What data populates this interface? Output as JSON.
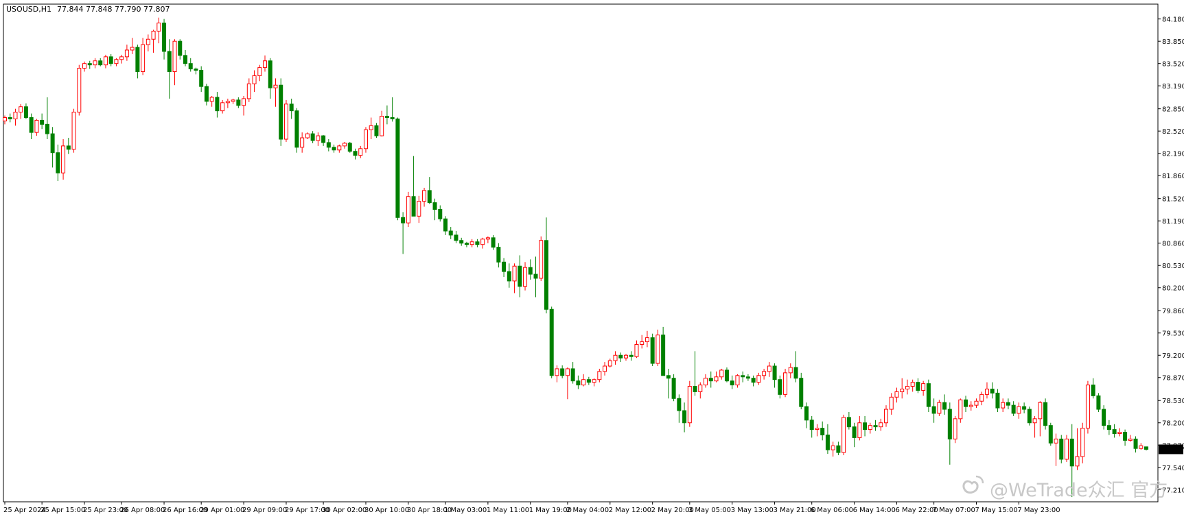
{
  "header": {
    "symbol": "USOUSD,H1",
    "ohlc": "77.844 77.848 77.790 77.807"
  },
  "watermark": {
    "text": "@WeTrade众汇 官方"
  },
  "colors": {
    "bull": "#ff0000",
    "bear": "#008000",
    "frame": "#000000",
    "price_tag_bg": "#000000",
    "price_tag_text": "#ffffff"
  },
  "chart_data": {
    "type": "candlestick",
    "ylim": [
      77.03,
      84.4
    ],
    "current_price": "77.807",
    "y_ticks": [
      "84.180",
      "83.850",
      "83.520",
      "83.190",
      "82.850",
      "82.520",
      "82.190",
      "81.860",
      "81.520",
      "81.190",
      "80.860",
      "80.530",
      "80.200",
      "79.860",
      "79.530",
      "79.200",
      "78.870",
      "78.530",
      "78.200",
      "77.870",
      "77.540",
      "77.210"
    ],
    "x_ticks": [
      {
        "label": "25 Apr 2024",
        "index": 0
      },
      {
        "label": "25 Apr 15:00",
        "index": 7
      },
      {
        "label": "25 Apr 23:00",
        "index": 15
      },
      {
        "label": "26 Apr 08:00",
        "index": 22
      },
      {
        "label": "26 Apr 16:00",
        "index": 30
      },
      {
        "label": "29 Apr 01:00",
        "index": 37
      },
      {
        "label": "29 Apr 09:00",
        "index": 45
      },
      {
        "label": "29 Apr 17:00",
        "index": 53
      },
      {
        "label": "30 Apr 02:00",
        "index": 60
      },
      {
        "label": "30 Apr 10:00",
        "index": 68
      },
      {
        "label": "30 Apr 18:00",
        "index": 76
      },
      {
        "label": "1 May 03:00",
        "index": 83
      },
      {
        "label": "1 May 11:00",
        "index": 91
      },
      {
        "label": "1 May 19:00",
        "index": 99
      },
      {
        "label": "2 May 04:00",
        "index": 106
      },
      {
        "label": "2 May 12:00",
        "index": 114
      },
      {
        "label": "2 May 20:00",
        "index": 122
      },
      {
        "label": "3 May 05:00",
        "index": 129
      },
      {
        "label": "3 May 13:00",
        "index": 137
      },
      {
        "label": "3 May 21:00",
        "index": 145
      },
      {
        "label": "6 May 06:00",
        "index": 152
      },
      {
        "label": "6 May 14:00",
        "index": 160
      },
      {
        "label": "6 May 22:00",
        "index": 168
      },
      {
        "label": "7 May 07:00",
        "index": 175
      },
      {
        "label": "7 May 15:00",
        "index": 183
      },
      {
        "label": "7 May 23:00",
        "index": 191
      }
    ],
    "candles": [
      [
        82.67,
        82.75,
        82.62,
        82.72
      ],
      [
        82.72,
        82.78,
        82.65,
        82.7
      ],
      [
        82.7,
        82.85,
        82.6,
        82.8
      ],
      [
        82.8,
        82.92,
        82.7,
        82.88
      ],
      [
        82.88,
        82.93,
        82.7,
        82.72
      ],
      [
        82.72,
        82.78,
        82.4,
        82.5
      ],
      [
        82.5,
        82.7,
        82.45,
        82.68
      ],
      [
        82.68,
        82.78,
        82.55,
        82.62
      ],
      [
        82.62,
        83.02,
        82.4,
        82.48
      ],
      [
        82.48,
        82.58,
        81.98,
        82.2
      ],
      [
        82.2,
        82.32,
        81.78,
        81.9
      ],
      [
        81.9,
        82.4,
        81.8,
        82.3
      ],
      [
        82.3,
        82.42,
        82.18,
        82.25
      ],
      [
        82.25,
        82.85,
        82.2,
        82.8
      ],
      [
        82.8,
        83.5,
        82.75,
        83.45
      ],
      [
        83.45,
        83.55,
        83.4,
        83.52
      ],
      [
        83.52,
        83.56,
        83.44,
        83.5
      ],
      [
        83.5,
        83.6,
        83.45,
        83.56
      ],
      [
        83.56,
        83.6,
        83.48,
        83.5
      ],
      [
        83.5,
        83.65,
        83.45,
        83.62
      ],
      [
        83.62,
        83.66,
        83.48,
        83.52
      ],
      [
        83.52,
        83.6,
        83.48,
        83.58
      ],
      [
        83.58,
        83.65,
        83.52,
        83.62
      ],
      [
        83.62,
        83.8,
        83.56,
        83.72
      ],
      [
        83.72,
        83.9,
        83.66,
        83.76
      ],
      [
        83.76,
        83.8,
        83.3,
        83.4
      ],
      [
        83.4,
        83.9,
        83.35,
        83.8
      ],
      [
        83.8,
        83.95,
        83.7,
        83.88
      ],
      [
        83.88,
        84.02,
        83.68,
        84.0
      ],
      [
        84.0,
        84.2,
        83.82,
        84.12
      ],
      [
        84.12,
        84.18,
        83.58,
        83.7
      ],
      [
        83.7,
        83.88,
        83.0,
        83.4
      ],
      [
        83.4,
        83.88,
        83.2,
        83.85
      ],
      [
        83.85,
        83.88,
        83.58,
        83.64
      ],
      [
        83.64,
        83.72,
        83.48,
        83.52
      ],
      [
        83.52,
        83.6,
        83.4,
        83.44
      ],
      [
        83.44,
        83.46,
        83.36,
        83.42
      ],
      [
        83.42,
        83.48,
        83.1,
        83.18
      ],
      [
        83.18,
        83.22,
        82.9,
        82.96
      ],
      [
        82.96,
        83.04,
        82.88,
        83.02
      ],
      [
        83.02,
        83.1,
        82.72,
        82.82
      ],
      [
        82.82,
        82.98,
        82.78,
        82.94
      ],
      [
        82.94,
        83.0,
        82.86,
        82.96
      ],
      [
        82.96,
        83.0,
        82.92,
        82.98
      ],
      [
        82.98,
        83.02,
        82.86,
        82.9
      ],
      [
        82.9,
        83.04,
        82.75,
        83.0
      ],
      [
        83.0,
        83.3,
        82.95,
        83.22
      ],
      [
        83.22,
        83.42,
        83.1,
        83.34
      ],
      [
        83.34,
        83.5,
        83.26,
        83.46
      ],
      [
        83.46,
        83.64,
        83.4,
        83.56
      ],
      [
        83.56,
        83.6,
        83.0,
        83.16
      ],
      [
        83.16,
        83.3,
        82.88,
        83.2
      ],
      [
        83.2,
        83.3,
        82.3,
        82.4
      ],
      [
        82.4,
        82.98,
        82.36,
        82.92
      ],
      [
        82.92,
        83.0,
        82.7,
        82.82
      ],
      [
        82.82,
        82.86,
        82.2,
        82.28
      ],
      [
        82.28,
        82.5,
        82.2,
        82.42
      ],
      [
        82.42,
        82.5,
        82.4,
        82.48
      ],
      [
        82.48,
        82.52,
        82.34,
        82.38
      ],
      [
        82.38,
        82.5,
        82.3,
        82.45
      ],
      [
        82.45,
        82.46,
        82.3,
        82.35
      ],
      [
        82.35,
        82.4,
        82.22,
        82.28
      ],
      [
        82.28,
        82.32,
        82.2,
        82.24
      ],
      [
        82.24,
        82.32,
        82.2,
        82.3
      ],
      [
        82.3,
        82.36,
        82.26,
        82.34
      ],
      [
        82.34,
        82.36,
        82.2,
        82.22
      ],
      [
        82.22,
        82.26,
        82.1,
        82.16
      ],
      [
        82.16,
        82.3,
        82.12,
        82.26
      ],
      [
        82.26,
        82.58,
        82.2,
        82.54
      ],
      [
        82.54,
        82.72,
        82.4,
        82.6
      ],
      [
        82.6,
        82.64,
        82.42,
        82.45
      ],
      [
        82.45,
        82.82,
        82.44,
        82.74
      ],
      [
        82.74,
        82.9,
        82.62,
        82.72
      ],
      [
        82.72,
        83.02,
        82.66,
        82.7
      ],
      [
        82.7,
        82.72,
        81.2,
        81.24
      ],
      [
        81.24,
        81.32,
        80.7,
        81.16
      ],
      [
        81.16,
        81.62,
        81.1,
        81.55
      ],
      [
        81.55,
        82.15,
        81.4,
        81.26
      ],
      [
        81.26,
        81.56,
        81.16,
        81.48
      ],
      [
        81.48,
        81.68,
        81.4,
        81.64
      ],
      [
        81.64,
        81.84,
        81.44,
        81.46
      ],
      [
        81.46,
        81.52,
        81.2,
        81.36
      ],
      [
        81.36,
        81.42,
        81.18,
        81.22
      ],
      [
        81.22,
        81.26,
        80.98,
        81.04
      ],
      [
        81.04,
        81.1,
        80.92,
        80.98
      ],
      [
        80.98,
        81.04,
        80.86,
        80.9
      ],
      [
        80.9,
        80.94,
        80.82,
        80.86
      ],
      [
        80.86,
        80.88,
        80.8,
        80.84
      ],
      [
        80.84,
        80.92,
        80.8,
        80.88
      ],
      [
        80.88,
        80.92,
        80.8,
        80.84
      ],
      [
        80.84,
        80.94,
        80.78,
        80.92
      ],
      [
        80.92,
        80.96,
        80.86,
        80.94
      ],
      [
        80.94,
        80.98,
        80.76,
        80.8
      ],
      [
        80.8,
        80.86,
        80.5,
        80.58
      ],
      [
        80.58,
        80.64,
        80.36,
        80.44
      ],
      [
        80.44,
        80.56,
        80.2,
        80.3
      ],
      [
        80.3,
        80.56,
        80.12,
        80.52
      ],
      [
        80.52,
        80.68,
        80.06,
        80.22
      ],
      [
        80.22,
        80.58,
        80.16,
        80.5
      ],
      [
        80.5,
        80.62,
        80.32,
        80.4
      ],
      [
        80.4,
        80.66,
        80.06,
        80.34
      ],
      [
        80.34,
        80.96,
        80.3,
        80.9
      ],
      [
        80.9,
        81.24,
        79.82,
        79.88
      ],
      [
        79.88,
        79.92,
        78.86,
        78.9
      ],
      [
        78.9,
        79.05,
        78.8,
        79.0
      ],
      [
        79.0,
        79.05,
        78.86,
        78.9
      ],
      [
        78.9,
        79.02,
        78.55,
        79.0
      ],
      [
        79.0,
        79.1,
        78.78,
        78.82
      ],
      [
        78.82,
        78.9,
        78.7,
        78.76
      ],
      [
        78.76,
        78.92,
        78.74,
        78.84
      ],
      [
        78.84,
        78.88,
        78.76,
        78.8
      ],
      [
        78.8,
        78.86,
        78.74,
        78.84
      ],
      [
        78.84,
        79.0,
        78.8,
        78.96
      ],
      [
        78.96,
        79.1,
        78.9,
        79.04
      ],
      [
        79.04,
        79.15,
        79.02,
        79.12
      ],
      [
        79.12,
        79.26,
        79.06,
        79.2
      ],
      [
        79.2,
        79.24,
        79.1,
        79.16
      ],
      [
        79.16,
        79.22,
        79.12,
        79.2
      ],
      [
        79.2,
        79.26,
        79.12,
        79.18
      ],
      [
        79.18,
        79.42,
        79.16,
        79.36
      ],
      [
        79.36,
        79.5,
        79.3,
        79.4
      ],
      [
        79.4,
        79.56,
        79.32,
        79.46
      ],
      [
        79.46,
        79.52,
        79.04,
        79.08
      ],
      [
        79.08,
        79.58,
        79.04,
        79.5
      ],
      [
        79.5,
        79.62,
        79.2,
        78.9
      ],
      [
        78.9,
        79.0,
        78.56,
        78.86
      ],
      [
        78.86,
        78.92,
        78.52,
        78.56
      ],
      [
        78.56,
        78.62,
        78.2,
        78.38
      ],
      [
        78.38,
        78.5,
        78.06,
        78.2
      ],
      [
        78.2,
        78.82,
        78.14,
        78.74
      ],
      [
        78.74,
        79.26,
        78.6,
        78.66
      ],
      [
        78.66,
        78.8,
        78.56,
        78.76
      ],
      [
        78.76,
        78.92,
        78.72,
        78.86
      ],
      [
        78.86,
        78.96,
        78.72,
        78.82
      ],
      [
        78.82,
        78.96,
        78.8,
        78.88
      ],
      [
        78.88,
        79.0,
        78.84,
        78.98
      ],
      [
        78.98,
        79.02,
        78.8,
        78.82
      ],
      [
        78.82,
        78.9,
        78.7,
        78.76
      ],
      [
        78.76,
        78.92,
        78.72,
        78.9
      ],
      [
        78.9,
        78.96,
        78.8,
        78.88
      ],
      [
        78.88,
        78.92,
        78.82,
        78.86
      ],
      [
        78.86,
        78.9,
        78.74,
        78.8
      ],
      [
        78.8,
        78.94,
        78.76,
        78.9
      ],
      [
        78.9,
        79.0,
        78.84,
        78.96
      ],
      [
        78.96,
        79.1,
        78.88,
        79.04
      ],
      [
        79.04,
        79.08,
        78.72,
        78.84
      ],
      [
        78.84,
        78.9,
        78.56,
        78.62
      ],
      [
        78.62,
        79.0,
        78.58,
        78.94
      ],
      [
        78.94,
        79.08,
        78.86,
        79.02
      ],
      [
        79.02,
        79.26,
        78.8,
        78.86
      ],
      [
        78.86,
        78.94,
        78.4,
        78.44
      ],
      [
        78.44,
        78.5,
        78.12,
        78.24
      ],
      [
        78.24,
        78.3,
        77.98,
        78.1
      ],
      [
        78.1,
        78.18,
        78.0,
        78.12
      ],
      [
        78.12,
        78.22,
        77.94,
        78.02
      ],
      [
        78.02,
        78.18,
        77.74,
        77.8
      ],
      [
        77.8,
        77.92,
        77.7,
        77.86
      ],
      [
        77.86,
        77.92,
        77.72,
        77.76
      ],
      [
        77.76,
        78.32,
        77.72,
        78.28
      ],
      [
        78.28,
        78.36,
        78.1,
        78.14
      ],
      [
        78.14,
        78.2,
        77.84,
        77.98
      ],
      [
        77.98,
        78.3,
        77.94,
        78.2
      ],
      [
        78.2,
        78.3,
        78.0,
        78.1
      ],
      [
        78.1,
        78.2,
        78.04,
        78.16
      ],
      [
        78.16,
        78.24,
        78.08,
        78.14
      ],
      [
        78.14,
        78.26,
        78.08,
        78.2
      ],
      [
        78.2,
        78.46,
        78.14,
        78.4
      ],
      [
        78.4,
        78.64,
        78.32,
        78.58
      ],
      [
        78.58,
        78.72,
        78.5,
        78.66
      ],
      [
        78.66,
        78.86,
        78.56,
        78.7
      ],
      [
        78.7,
        78.84,
        78.62,
        78.74
      ],
      [
        78.74,
        78.84,
        78.66,
        78.8
      ],
      [
        78.8,
        78.86,
        78.64,
        78.68
      ],
      [
        78.68,
        78.82,
        78.6,
        78.78
      ],
      [
        78.78,
        78.84,
        78.36,
        78.44
      ],
      [
        78.44,
        78.56,
        78.2,
        78.34
      ],
      [
        78.34,
        78.54,
        78.3,
        78.5
      ],
      [
        78.5,
        78.62,
        78.32,
        78.4
      ],
      [
        78.4,
        78.5,
        77.58,
        77.96
      ],
      [
        77.96,
        78.3,
        77.9,
        78.26
      ],
      [
        78.26,
        78.56,
        78.2,
        78.54
      ],
      [
        78.54,
        78.6,
        78.36,
        78.44
      ],
      [
        78.44,
        78.52,
        78.38,
        78.46
      ],
      [
        78.46,
        78.56,
        78.42,
        78.52
      ],
      [
        78.52,
        78.66,
        78.46,
        78.62
      ],
      [
        78.62,
        78.8,
        78.56,
        78.7
      ],
      [
        78.7,
        78.8,
        78.56,
        78.64
      ],
      [
        78.64,
        78.7,
        78.36,
        78.42
      ],
      [
        78.42,
        78.56,
        78.36,
        78.5
      ],
      [
        78.5,
        78.56,
        78.4,
        78.46
      ],
      [
        78.46,
        78.52,
        78.3,
        78.34
      ],
      [
        78.34,
        78.5,
        78.26,
        78.44
      ],
      [
        78.44,
        78.5,
        78.34,
        78.4
      ],
      [
        78.4,
        78.44,
        78.16,
        78.2
      ],
      [
        78.2,
        78.3,
        77.98,
        78.26
      ],
      [
        78.26,
        78.52,
        78.0,
        78.5
      ],
      [
        78.5,
        78.56,
        78.1,
        78.16
      ],
      [
        78.16,
        78.2,
        77.86,
        77.9
      ],
      [
        77.9,
        78.04,
        77.56,
        77.96
      ],
      [
        77.96,
        78.02,
        77.6,
        77.66
      ],
      [
        77.66,
        78.02,
        77.62,
        77.96
      ],
      [
        77.96,
        78.18,
        77.1,
        77.56
      ],
      [
        77.56,
        78.12,
        77.5,
        77.7
      ],
      [
        77.7,
        78.2,
        77.6,
        78.12
      ],
      [
        78.12,
        78.82,
        78.04,
        78.76
      ],
      [
        78.76,
        78.86,
        78.56,
        78.6
      ],
      [
        78.6,
        78.64,
        78.36,
        78.4
      ],
      [
        78.4,
        78.46,
        78.1,
        78.16
      ],
      [
        78.16,
        78.24,
        78.02,
        78.1
      ],
      [
        78.1,
        78.18,
        77.98,
        78.04
      ],
      [
        78.04,
        78.12,
        78.0,
        78.06
      ],
      [
        78.06,
        78.1,
        77.86,
        77.94
      ],
      [
        77.94,
        78.02,
        77.92,
        77.96
      ],
      [
        77.96,
        78.0,
        77.76,
        77.82
      ],
      [
        77.82,
        77.9,
        77.8,
        77.86
      ],
      [
        77.844,
        77.848,
        77.79,
        77.807
      ]
    ]
  }
}
